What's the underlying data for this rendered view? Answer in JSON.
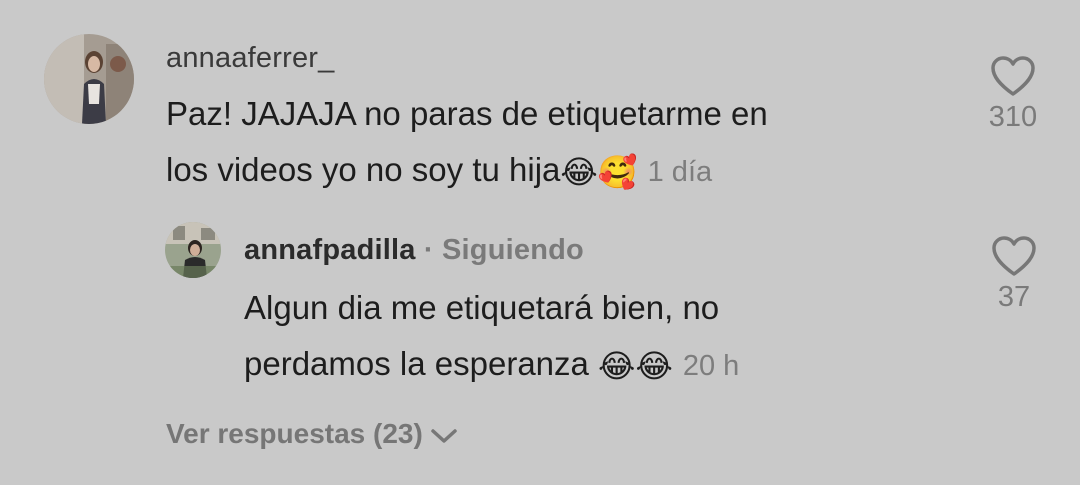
{
  "comment": {
    "username": "annaaferrer_",
    "text_line1": "Paz! JAJAJA no paras de etiquetarme en",
    "text_line2": "los videos yo no soy tu hija",
    "emojis": [
      "😂",
      "🥰"
    ],
    "timestamp": "1 día",
    "like_count": "310"
  },
  "reply": {
    "username": "annafpadilla",
    "separator": "·",
    "status": "Siguiendo",
    "text_line1": "Algun dia me etiquetará bien, no",
    "text_line2": "perdamos la esperanza ",
    "emojis": [
      "😂",
      "😂"
    ],
    "timestamp": "20 h",
    "like_count": "37"
  },
  "view_replies": {
    "label": "Ver respuestas (23)",
    "icon": "chevron-down-icon"
  },
  "colors": {
    "background": "#c9c9c9",
    "text": "#1d1d1d",
    "muted": "#7a7a7a"
  }
}
